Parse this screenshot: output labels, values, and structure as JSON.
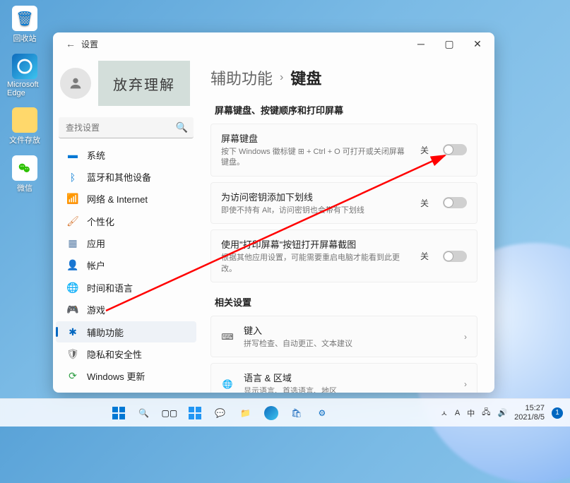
{
  "desktop": {
    "recycle": "回收站",
    "edge": "Microsoft Edge",
    "folder": "文件存放",
    "wechat": "微信"
  },
  "window": {
    "title": "设置",
    "handwriting": "放弃理解",
    "search_placeholder": "查找设置"
  },
  "nav": [
    {
      "label": "系统"
    },
    {
      "label": "蓝牙和其他设备"
    },
    {
      "label": "网络 & Internet"
    },
    {
      "label": "个性化"
    },
    {
      "label": "应用"
    },
    {
      "label": "帐户"
    },
    {
      "label": "时间和语言"
    },
    {
      "label": "游戏"
    },
    {
      "label": "辅助功能"
    },
    {
      "label": "隐私和安全性"
    },
    {
      "label": "Windows 更新"
    }
  ],
  "breadcrumb": {
    "parent": "辅助功能",
    "current": "键盘"
  },
  "section1": "屏幕键盘、按键顺序和打印屏幕",
  "cards": [
    {
      "title": "屏幕键盘",
      "sub": "按下 Windows 徽标键 ⊞ + Ctrl + O 可打开或关闭屏幕键盘。",
      "state": "关"
    },
    {
      "title": "为访问密钥添加下划线",
      "sub": "即使不持有 Alt，访问密钥也会带有下划线",
      "state": "关"
    },
    {
      "title": "使用\"打印屏幕\"按钮打开屏幕截图",
      "sub": "根据其他应用设置，可能需要重启电脑才能看到此更改。",
      "state": "关"
    }
  ],
  "section2": "相关设置",
  "related": [
    {
      "title": "键入",
      "sub": "拼写检查、自动更正、文本建议"
    },
    {
      "title": "语言 & 区域",
      "sub": "显示语言、首选语言、地区"
    }
  ],
  "tray": {
    "lang": "中",
    "ime": "A",
    "time": "15:27",
    "date": "2021/8/5",
    "notif": "1",
    "up": "ㅅ"
  }
}
